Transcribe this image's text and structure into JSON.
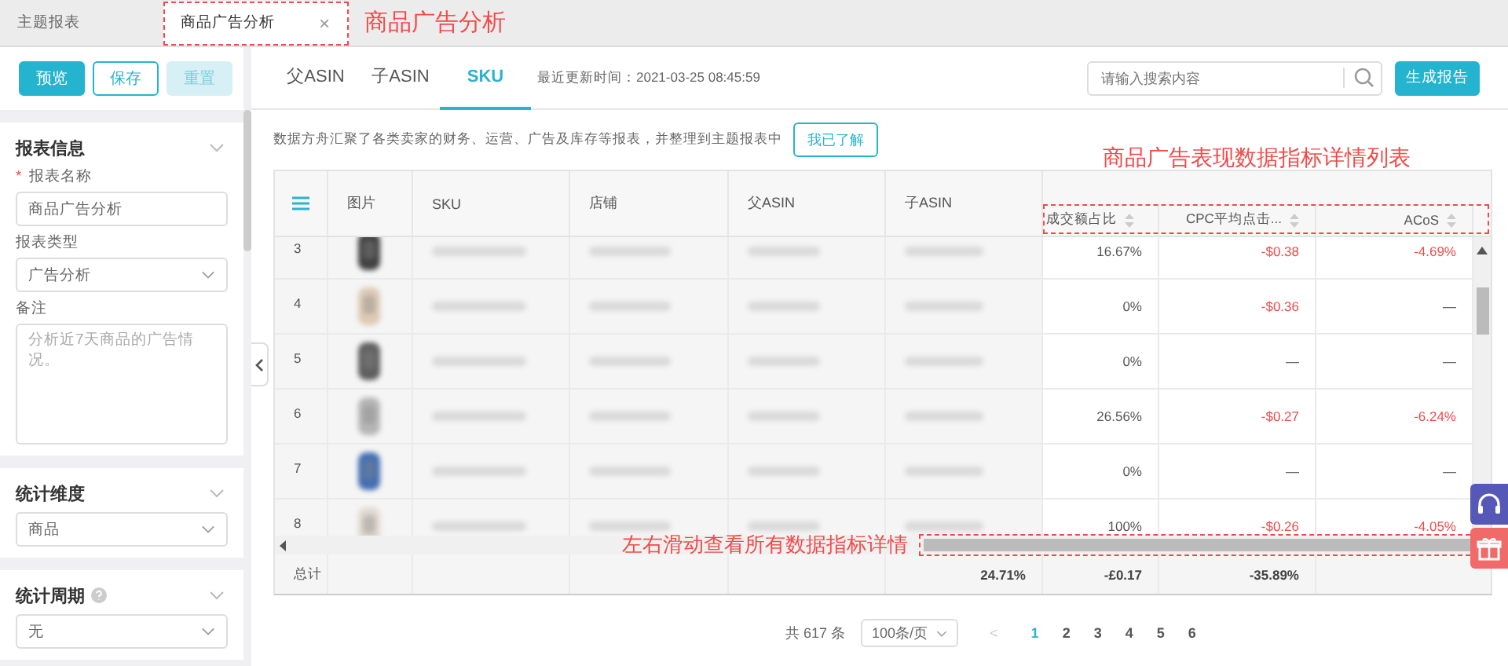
{
  "tabs": [
    {
      "label": "主题报表",
      "selected": false
    },
    {
      "label": "商品广告分析",
      "selected": true,
      "close": "×"
    }
  ],
  "tab_note": "商品广告分析",
  "sidebar": {
    "buttons": [
      {
        "label": "预览",
        "kind": "primary"
      },
      {
        "label": "保存",
        "kind": "outline"
      },
      {
        "label": "重置",
        "kind": "light"
      }
    ],
    "sections": [
      {
        "title": "报表信息",
        "fields": [
          {
            "label": "报表名称",
            "required_mark": "*",
            "kind": "input",
            "value": "商品广告分析"
          },
          {
            "label": "报表类型",
            "kind": "select",
            "value": "广告分析"
          },
          {
            "label": "备注",
            "kind": "textarea",
            "placeholder": "分析近7天商品的广告情况。"
          }
        ]
      },
      {
        "title": "统计维度",
        "fields": [
          {
            "kind": "select",
            "value": "商品"
          }
        ]
      },
      {
        "title": "统计周期",
        "help": true,
        "fields": [
          {
            "kind": "select",
            "value": "无"
          }
        ]
      }
    ]
  },
  "view_tabs": [
    {
      "label": "父ASIN",
      "selected": false
    },
    {
      "label": "子ASIN",
      "selected": false
    },
    {
      "label": "SKU",
      "selected": true
    }
  ],
  "updated": "最近更新时间：2021-03-25 08:45:59",
  "search": {
    "placeholder": "请输入搜索内容"
  },
  "generate_button": "生成报告",
  "notice": {
    "text": "数据方舟汇聚了各类卖家的财务、运营、广告及库存等报表，并整理到主题报表中",
    "button": "我已了解"
  },
  "table_note": "商品广告表现数据指标详情列表",
  "table": {
    "columns": [
      {
        "label": "图片"
      },
      {
        "label": "SKU"
      },
      {
        "label": "店铺"
      },
      {
        "label": "父ASIN"
      },
      {
        "label": "子ASIN"
      },
      {
        "label": "成交额占比",
        "sortable": true
      },
      {
        "label": "CPC平均点击...",
        "sortable": true
      },
      {
        "label": "ACoS",
        "sortable": true
      }
    ],
    "rows": [
      {
        "index": "3",
        "cells": [
          {
            "text": "16.67%",
            "negative": false
          },
          {
            "text": "-$0.38",
            "negative": true
          },
          {
            "text": "-4.69%",
            "negative": true
          }
        ]
      },
      {
        "index": "4",
        "cells": [
          {
            "text": "0%",
            "negative": false
          },
          {
            "text": "-$0.36",
            "negative": true
          },
          {
            "text": "—",
            "negative": false
          }
        ]
      },
      {
        "index": "5",
        "cells": [
          {
            "text": "0%",
            "negative": false
          },
          {
            "text": "—",
            "negative": false
          },
          {
            "text": "—",
            "negative": false
          }
        ]
      },
      {
        "index": "6",
        "cells": [
          {
            "text": "26.56%",
            "negative": false
          },
          {
            "text": "-$0.27",
            "negative": true
          },
          {
            "text": "-6.24%",
            "negative": true
          }
        ]
      },
      {
        "index": "7",
        "cells": [
          {
            "text": "0%",
            "negative": false
          },
          {
            "text": "—",
            "negative": false
          },
          {
            "text": "—",
            "negative": false
          }
        ]
      },
      {
        "index": "8",
        "cells": [
          {
            "text": "100%",
            "negative": false
          },
          {
            "text": "-$0.26",
            "negative": true
          },
          {
            "text": "-4.05%",
            "negative": true
          }
        ]
      }
    ],
    "total": {
      "label": "总计",
      "cells": [
        "24.71%",
        "-£0.17",
        "-35.89%"
      ]
    }
  },
  "scroll_note": "左右滑动查看所有数据指标详情",
  "pagination": {
    "total": "共 617 条",
    "page_size": "100条/页",
    "prev": "<",
    "pages": [
      {
        "label": "1",
        "selected": true
      },
      {
        "label": "2",
        "selected": false
      },
      {
        "label": "3",
        "selected": false
      },
      {
        "label": "4",
        "selected": false
      },
      {
        "label": "5",
        "selected": false
      },
      {
        "label": "6",
        "selected": false
      }
    ]
  }
}
